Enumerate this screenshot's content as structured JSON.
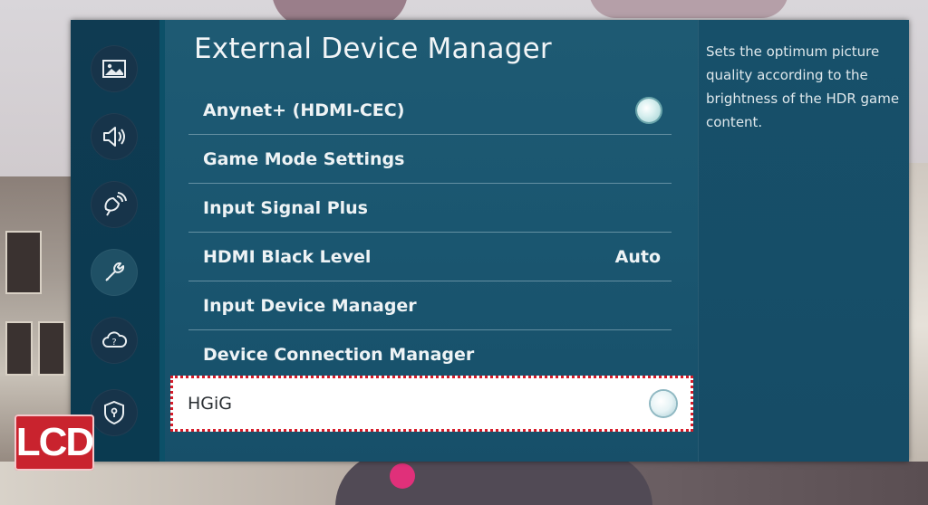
{
  "header": {
    "title": "External Device Manager"
  },
  "sidebar": {
    "icons": [
      {
        "name": "picture-icon"
      },
      {
        "name": "sound-icon"
      },
      {
        "name": "broadcast-icon"
      },
      {
        "name": "general-wrench-icon",
        "active": true
      },
      {
        "name": "support-cloud-icon"
      },
      {
        "name": "privacy-shield-icon"
      }
    ]
  },
  "menu": {
    "items": [
      {
        "label": "Anynet+ (HDMI-CEC)",
        "value": "",
        "toggle": true
      },
      {
        "label": "Game Mode Settings",
        "value": ""
      },
      {
        "label": "Input Signal Plus",
        "value": ""
      },
      {
        "label": "HDMI Black Level",
        "value": "Auto"
      },
      {
        "label": "Input Device Manager",
        "value": ""
      },
      {
        "label": "Device Connection Manager",
        "value": ""
      }
    ],
    "selected": {
      "label": "HGiG",
      "toggle": true
    }
  },
  "description": {
    "text": "Sets the optimum picture quality according to the brightness of the HDR game content."
  },
  "watermark": {
    "text": "LCD"
  },
  "colors": {
    "panel": "#153d56",
    "list_bg": "#1e5a73",
    "highlight_border": "#d61c2a",
    "logo": "#c9232e"
  }
}
